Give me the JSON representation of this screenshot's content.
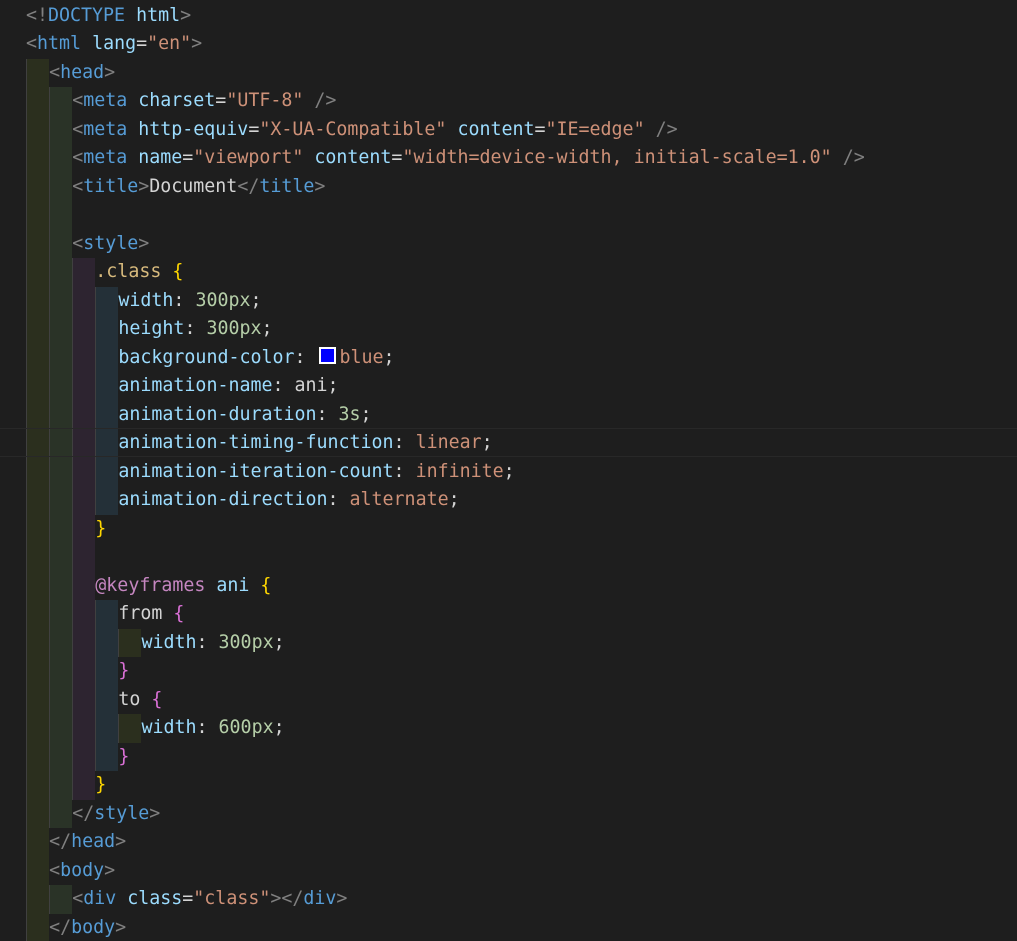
{
  "editor": {
    "language": "html",
    "theme": "dark",
    "colors": {
      "background": "#1e1e1e",
      "tag": "#569cd6",
      "attribute": "#9cdcfe",
      "string": "#ce9178",
      "selector": "#d7ba7d",
      "number": "#b5cea8",
      "bracket_level_1": "#ffd700",
      "bracket_level_2": "#da70d6",
      "at_rule": "#c586c0",
      "color_swatch": "#0000ff"
    },
    "lines": [
      {
        "indent": 0,
        "tokens": [
          [
            "punct",
            "<!"
          ],
          [
            "tag",
            "DOCTYPE"
          ],
          [
            "text",
            " "
          ],
          [
            "attr",
            "html"
          ],
          [
            "punct",
            ">"
          ]
        ]
      },
      {
        "indent": 0,
        "tokens": [
          [
            "punct",
            "<"
          ],
          [
            "tag",
            "html"
          ],
          [
            "text",
            " "
          ],
          [
            "attr",
            "lang"
          ],
          [
            "eq",
            "="
          ],
          [
            "str",
            "\"en\""
          ],
          [
            "punct",
            ">"
          ]
        ]
      },
      {
        "indent": 1,
        "tokens": [
          [
            "punct",
            "<"
          ],
          [
            "tag",
            "head"
          ],
          [
            "punct",
            ">"
          ]
        ]
      },
      {
        "indent": 2,
        "tokens": [
          [
            "punct",
            "<"
          ],
          [
            "tag",
            "meta"
          ],
          [
            "text",
            " "
          ],
          [
            "attr",
            "charset"
          ],
          [
            "eq",
            "="
          ],
          [
            "str",
            "\"UTF-8\""
          ],
          [
            "text",
            " "
          ],
          [
            "punct",
            "/>"
          ]
        ]
      },
      {
        "indent": 2,
        "tokens": [
          [
            "punct",
            "<"
          ],
          [
            "tag",
            "meta"
          ],
          [
            "text",
            " "
          ],
          [
            "attr",
            "http-equiv"
          ],
          [
            "eq",
            "="
          ],
          [
            "str",
            "\"X-UA-Compatible\""
          ],
          [
            "text",
            " "
          ],
          [
            "attr",
            "content"
          ],
          [
            "eq",
            "="
          ],
          [
            "str",
            "\"IE=edge\""
          ],
          [
            "text",
            " "
          ],
          [
            "punct",
            "/>"
          ]
        ]
      },
      {
        "indent": 2,
        "tokens": [
          [
            "punct",
            "<"
          ],
          [
            "tag",
            "meta"
          ],
          [
            "text",
            " "
          ],
          [
            "attr",
            "name"
          ],
          [
            "eq",
            "="
          ],
          [
            "str",
            "\"viewport\""
          ],
          [
            "text",
            " "
          ],
          [
            "attr",
            "content"
          ],
          [
            "eq",
            "="
          ],
          [
            "str",
            "\"width=device-width, initial-scale=1.0\""
          ],
          [
            "text",
            " "
          ],
          [
            "punct",
            "/>"
          ]
        ]
      },
      {
        "indent": 2,
        "tokens": [
          [
            "punct",
            "<"
          ],
          [
            "tag",
            "title"
          ],
          [
            "punct",
            ">"
          ],
          [
            "text",
            "Document"
          ],
          [
            "punct",
            "</"
          ],
          [
            "tag",
            "title"
          ],
          [
            "punct",
            ">"
          ]
        ]
      },
      {
        "indent": 0,
        "tokens": []
      },
      {
        "indent": 2,
        "tokens": [
          [
            "punct",
            "<"
          ],
          [
            "tag",
            "style"
          ],
          [
            "punct",
            ">"
          ]
        ]
      },
      {
        "indent": 3,
        "tokens": [
          [
            "sel",
            ".class"
          ],
          [
            "text",
            " "
          ],
          [
            "b1",
            "{"
          ]
        ]
      },
      {
        "indent": 4,
        "tokens": [
          [
            "prop",
            "width"
          ],
          [
            "plain",
            ": "
          ],
          [
            "num",
            "300px"
          ],
          [
            "plain",
            ";"
          ]
        ]
      },
      {
        "indent": 4,
        "tokens": [
          [
            "prop",
            "height"
          ],
          [
            "plain",
            ": "
          ],
          [
            "num",
            "300px"
          ],
          [
            "plain",
            ";"
          ]
        ]
      },
      {
        "indent": 4,
        "tokens": [
          [
            "prop",
            "background-color"
          ],
          [
            "plain",
            ": "
          ],
          [
            "swatch",
            "blue"
          ],
          [
            "val",
            "blue"
          ],
          [
            "plain",
            ";"
          ]
        ]
      },
      {
        "indent": 4,
        "tokens": [
          [
            "prop",
            "animation-name"
          ],
          [
            "plain",
            ": ani;"
          ]
        ]
      },
      {
        "indent": 4,
        "tokens": [
          [
            "prop",
            "animation-duration"
          ],
          [
            "plain",
            ": "
          ],
          [
            "num",
            "3s"
          ],
          [
            "plain",
            ";"
          ]
        ]
      },
      {
        "indent": 4,
        "tokens": [
          [
            "prop",
            "animation-timing-function"
          ],
          [
            "plain",
            ": "
          ],
          [
            "val",
            "linear"
          ],
          [
            "plain",
            ";"
          ]
        ]
      },
      {
        "indent": 4,
        "tokens": [
          [
            "prop",
            "animation-iteration-count"
          ],
          [
            "plain",
            ": "
          ],
          [
            "val",
            "infinite"
          ],
          [
            "plain",
            ";"
          ]
        ]
      },
      {
        "indent": 4,
        "tokens": [
          [
            "prop",
            "animation-direction"
          ],
          [
            "plain",
            ": "
          ],
          [
            "val",
            "alternate"
          ],
          [
            "plain",
            ";"
          ]
        ]
      },
      {
        "indent": 3,
        "tokens": [
          [
            "b1",
            "}"
          ]
        ]
      },
      {
        "indent": 0,
        "tokens": []
      },
      {
        "indent": 3,
        "tokens": [
          [
            "atkw",
            "@keyframes"
          ],
          [
            "text",
            " "
          ],
          [
            "kfname",
            "ani"
          ],
          [
            "text",
            " "
          ],
          [
            "b1",
            "{"
          ]
        ]
      },
      {
        "indent": 4,
        "tokens": [
          [
            "plain",
            "from "
          ],
          [
            "b2",
            "{"
          ]
        ]
      },
      {
        "indent": 5,
        "tokens": [
          [
            "prop",
            "width"
          ],
          [
            "plain",
            ": "
          ],
          [
            "num",
            "300px"
          ],
          [
            "plain",
            ";"
          ]
        ]
      },
      {
        "indent": 4,
        "tokens": [
          [
            "b2",
            "}"
          ]
        ]
      },
      {
        "indent": 4,
        "tokens": [
          [
            "plain",
            "to "
          ],
          [
            "b2",
            "{"
          ]
        ]
      },
      {
        "indent": 5,
        "tokens": [
          [
            "prop",
            "width"
          ],
          [
            "plain",
            ": "
          ],
          [
            "num",
            "600px"
          ],
          [
            "plain",
            ";"
          ]
        ]
      },
      {
        "indent": 4,
        "tokens": [
          [
            "b2",
            "}"
          ]
        ]
      },
      {
        "indent": 3,
        "tokens": [
          [
            "b1",
            "}"
          ]
        ]
      },
      {
        "indent": 2,
        "tokens": [
          [
            "punct",
            "</"
          ],
          [
            "tag",
            "style"
          ],
          [
            "punct",
            ">"
          ]
        ]
      },
      {
        "indent": 1,
        "tokens": [
          [
            "punct",
            "</"
          ],
          [
            "tag",
            "head"
          ],
          [
            "punct",
            ">"
          ]
        ]
      },
      {
        "indent": 1,
        "tokens": [
          [
            "punct",
            "<"
          ],
          [
            "tag",
            "body"
          ],
          [
            "punct",
            ">"
          ]
        ]
      },
      {
        "indent": 2,
        "tokens": [
          [
            "punct",
            "<"
          ],
          [
            "tag",
            "div"
          ],
          [
            "text",
            " "
          ],
          [
            "attr",
            "class"
          ],
          [
            "eq",
            "="
          ],
          [
            "str",
            "\"class\""
          ],
          [
            "punct",
            "></"
          ],
          [
            "tag",
            "div"
          ],
          [
            "punct",
            ">"
          ]
        ]
      },
      {
        "indent": 1,
        "tokens": [
          [
            "punct",
            "</"
          ],
          [
            "tag",
            "body"
          ],
          [
            "punct",
            ">"
          ]
        ]
      }
    ]
  }
}
